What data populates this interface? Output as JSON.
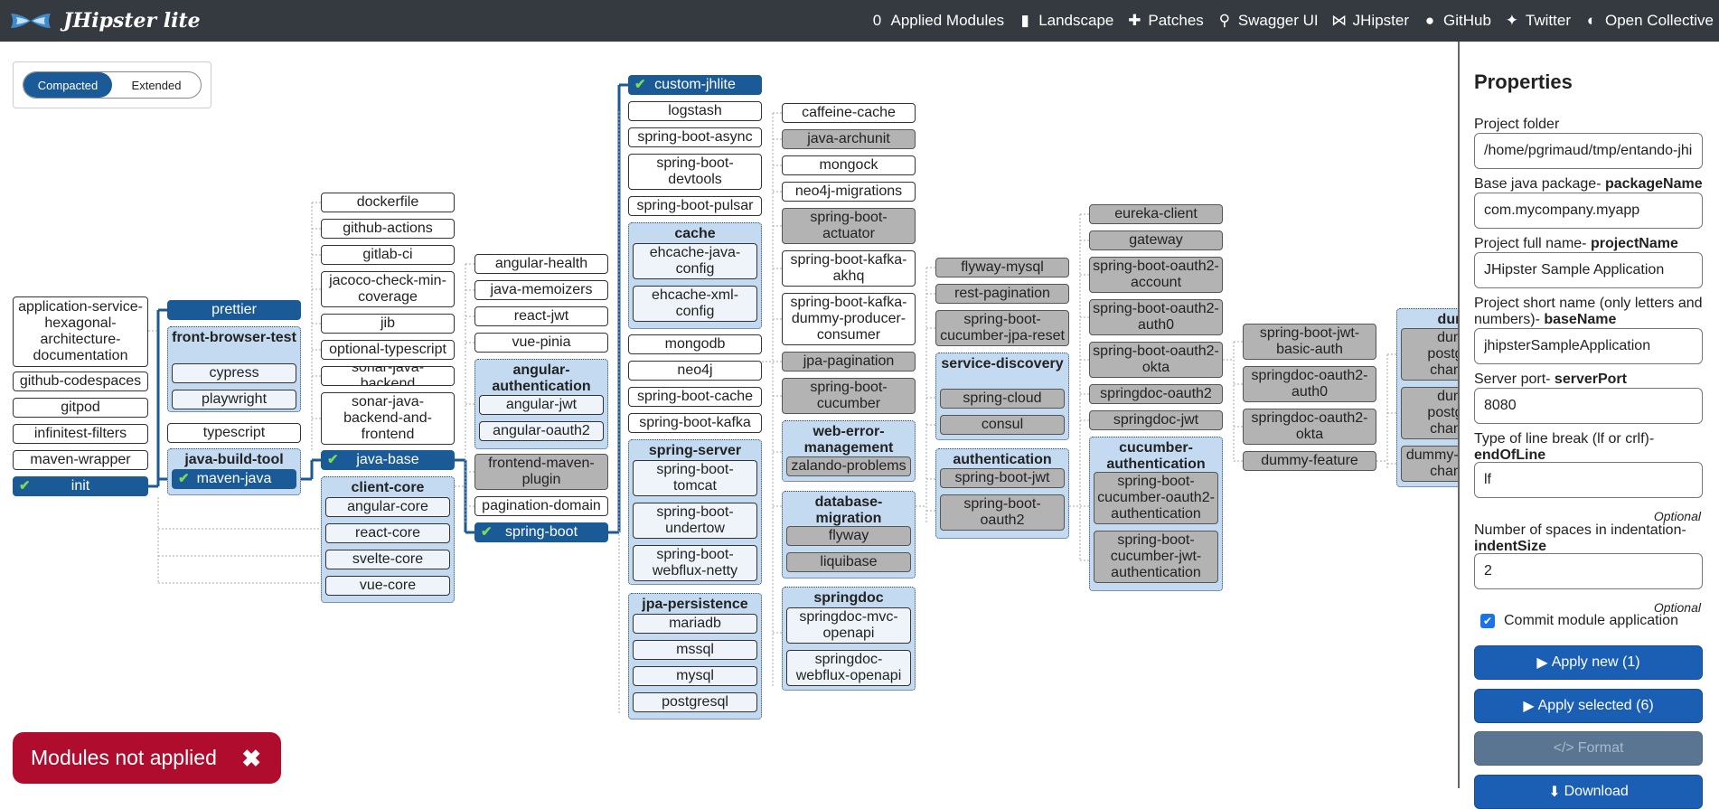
{
  "app": {
    "title": "JHipster lite"
  },
  "nav": [
    {
      "label": "Applied Modules",
      "icon": "zero-icon",
      "glyph": "0"
    },
    {
      "label": "Landscape",
      "icon": "map-icon",
      "glyph": "▮"
    },
    {
      "label": "Patches",
      "icon": "puzzle-icon",
      "glyph": "✚"
    },
    {
      "label": "Swagger UI",
      "icon": "binoculars-icon",
      "glyph": "⚲"
    },
    {
      "label": "JHipster",
      "icon": "bowtie-icon",
      "glyph": "⋈"
    },
    {
      "label": "GitHub",
      "icon": "github-icon",
      "glyph": "●"
    },
    {
      "label": "Twitter",
      "icon": "twitter-icon",
      "glyph": "✦"
    },
    {
      "label": "Open Collective",
      "icon": "opencollective-icon",
      "glyph": "◐"
    }
  ],
  "mode": {
    "compacted": "Compacted",
    "extended": "Extended",
    "selected": "Compacted"
  },
  "landscape": {
    "groups": {
      "front_browser_test": "front-browser-test",
      "java_build_tool": "java-build-tool",
      "client_core": "client-core",
      "angular_authentication": "angular-authentication",
      "cache": "cache",
      "spring_server": "spring-server",
      "jpa_persistence": "jpa-persistence",
      "web_error_management": "web-error-management",
      "database_migration": "database-migration",
      "springdoc": "springdoc",
      "service_discovery": "service-discovery",
      "authentication": "authentication",
      "cucumber_authentication": "cucumber-authentication",
      "dummy": "dummy"
    },
    "modules": {
      "application_service_hexagonal": "application-service-hexagonal-architecture-documentation",
      "github_codespaces": "github-codespaces",
      "gitpod": "gitpod",
      "infinitest_filters": "infinitest-filters",
      "maven_wrapper": "maven-wrapper",
      "init": "init",
      "prettier": "prettier",
      "cypress": "cypress",
      "playwright": "playwright",
      "typescript": "typescript",
      "maven_java": "maven-java",
      "dockerfile": "dockerfile",
      "github_actions": "github-actions",
      "gitlab_ci": "gitlab-ci",
      "jacoco": "jacoco-check-min-coverage",
      "jib": "jib",
      "optional_typescript": "optional-typescript",
      "sonar_java_backend": "sonar-java-backend",
      "sonar_java_backend_and_frontend": "sonar-java-backend-and-frontend",
      "java_base": "java-base",
      "angular_core": "angular-core",
      "react_core": "react-core",
      "svelte_core": "svelte-core",
      "vue_core": "vue-core",
      "angular_health": "angular-health",
      "java_memoizers": "java-memoizers",
      "react_jwt": "react-jwt",
      "vue_pinia": "vue-pinia",
      "angular_jwt": "angular-jwt",
      "angular_oauth2": "angular-oauth2",
      "frontend_maven_plugin": "frontend-maven-plugin",
      "pagination_domain": "pagination-domain",
      "spring_boot": "spring-boot",
      "custom_jhlite": "custom-jhlite",
      "logstash": "logstash",
      "spring_boot_async": "spring-boot-async",
      "spring_boot_devtools": "spring-boot-devtools",
      "spring_boot_pulsar": "spring-boot-pulsar",
      "ehcache_java_config": "ehcache-java-config",
      "ehcache_xml_config": "ehcache-xml-config",
      "mongodb": "mongodb",
      "neo4j": "neo4j",
      "spring_boot_cache": "spring-boot-cache",
      "spring_boot_kafka": "spring-boot-kafka",
      "spring_boot_tomcat": "spring-boot-tomcat",
      "spring_boot_undertow": "spring-boot-undertow",
      "spring_boot_webflux_netty": "spring-boot-webflux-netty",
      "mariadb": "mariadb",
      "mssql": "mssql",
      "mysql": "mysql",
      "postgresql": "postgresql",
      "caffeine_cache": "caffeine-cache",
      "java_archunit": "java-archunit",
      "mongock": "mongock",
      "neo4j_migrations": "neo4j-migrations",
      "spring_boot_actuator": "spring-boot-actuator",
      "spring_boot_kafka_akhq": "spring-boot-kafka-akhq",
      "spring_boot_kafka_dummy": "spring-boot-kafka-dummy-producer-consumer",
      "jpa_pagination": "jpa-pagination",
      "spring_boot_cucumber": "spring-boot-cucumber",
      "zalando_problems": "zalando-problems",
      "flyway": "flyway",
      "liquibase": "liquibase",
      "springdoc_mvc_openapi": "springdoc-mvc-openapi",
      "springdoc_webflux_openapi": "springdoc-webflux-openapi",
      "flyway_mysql": "flyway-mysql",
      "rest_pagination": "rest-pagination",
      "spring_boot_cucumber_jpa_reset": "spring-boot-cucumber-jpa-reset",
      "spring_cloud": "spring-cloud",
      "consul": "consul",
      "spring_boot_jwt": "spring-boot-jwt",
      "spring_boot_oauth2": "spring-boot-oauth2",
      "eureka_client": "eureka-client",
      "gateway": "gateway",
      "spring_boot_oauth2_account": "spring-boot-oauth2-account",
      "spring_boot_oauth2_auth0": "spring-boot-oauth2-auth0",
      "spring_boot_oauth2_okta": "spring-boot-oauth2-okta",
      "springdoc_oauth2": "springdoc-oauth2",
      "springdoc_jwt": "springdoc-jwt",
      "spring_boot_cucumber_oauth2": "spring-boot-cucumber-oauth2-authentication",
      "spring_boot_cucumber_jwt": "spring-boot-cucumber-jwt-authentication",
      "spring_boot_jwt_basic_auth": "spring-boot-jwt-basic-auth",
      "springdoc_oauth2_auth0": "springdoc-oauth2-auth0",
      "springdoc_oauth2_okta": "springdoc-oauth2-okta",
      "dummy_feature": "dummy-feature",
      "dummy_1": "dummy-postgresql-changelog",
      "dummy_2": "dummy-postgresql-changelog",
      "dummy_3": "dummy-liquibase-changelog"
    },
    "applied_modules": [
      "init",
      "maven-java",
      "java-base",
      "spring-boot",
      "custom-jhlite"
    ]
  },
  "properties": {
    "title": "Properties",
    "fields": [
      {
        "label": "Project folder",
        "key": "",
        "value": "/home/pgrimaud/tmp/entando-jhi",
        "optional": ""
      },
      {
        "label": "Base java package- ",
        "key": "packageName",
        "value": "com.mycompany.myapp",
        "optional": ""
      },
      {
        "label": "Project full name- ",
        "key": "projectName",
        "value": "JHipster Sample Application",
        "optional": ""
      },
      {
        "label": "Project short name (only letters and numbers)- ",
        "key": "baseName",
        "value": "jhipsterSampleApplication",
        "optional": ""
      },
      {
        "label": "Server port- ",
        "key": "serverPort",
        "value": "8080",
        "optional": ""
      },
      {
        "label": "Type of line break (lf or crlf)- ",
        "key": "endOfLine",
        "value": "lf",
        "optional": "Optional"
      },
      {
        "label": "Number of spaces in indentation- ",
        "key": "indentSize",
        "value": "2",
        "optional": "Optional"
      }
    ],
    "commit_label": "Commit module application",
    "commit_checked": true,
    "apply_new": "Apply new (1)",
    "apply_selected": "Apply selected (6)",
    "format": "Format",
    "download": "Download"
  },
  "alert": {
    "text": "Modules not applied"
  },
  "colors": {
    "topbar": "#343a40",
    "applied": "#1a5a96",
    "alert": "#b00d2e",
    "button": "#1a5fb4",
    "group": "#c3daf0",
    "unavailable": "#b3b3b3"
  }
}
